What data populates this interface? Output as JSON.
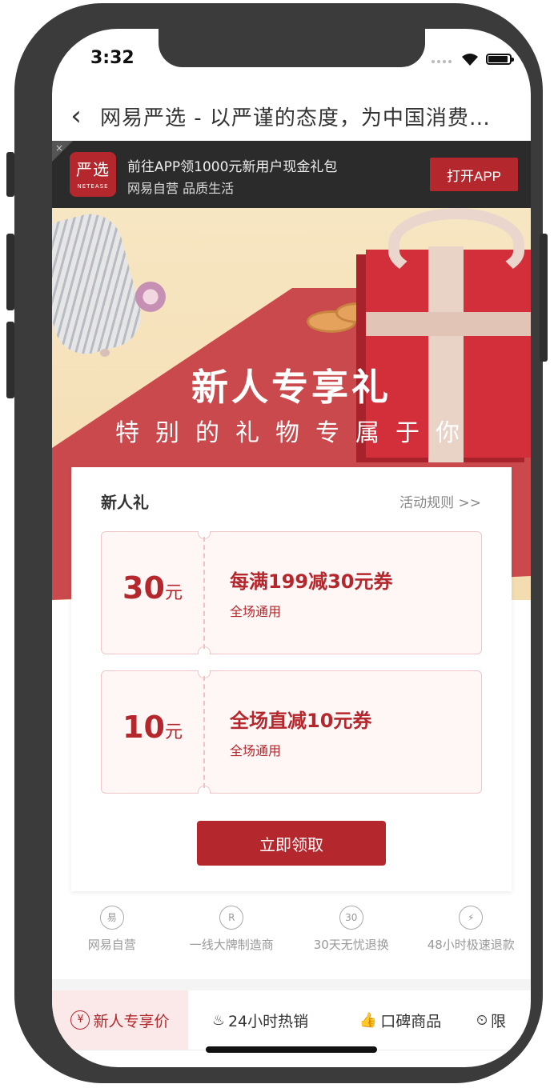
{
  "status": {
    "time": "3:32"
  },
  "nav": {
    "back_icon": "chevron-left-icon",
    "title": "网易严选 - 以严谨的态度，为中国消费者甄选天下优品"
  },
  "appbar": {
    "logo_cn": "严选",
    "logo_en": "NETEASE",
    "line1": "前往APP领1000元新用户现金礼包",
    "line2": "网易自营 品质生活",
    "open_label": "打开APP",
    "close_glyph": "×"
  },
  "hero": {
    "title": "新人专享礼",
    "subtitle": "特别的礼物专属于你"
  },
  "card": {
    "title": "新人礼",
    "rules": "活动规则 >>",
    "coupons": [
      {
        "amount": "30",
        "unit": "元",
        "title": "每满199减30元券",
        "sub": "全场通用"
      },
      {
        "amount": "10",
        "unit": "元",
        "title": "全场直减10元券",
        "sub": "全场通用"
      }
    ],
    "claim_label": "立即领取"
  },
  "features": [
    {
      "icon": "易",
      "label": "网易自营"
    },
    {
      "icon": "R",
      "label": "一线大牌制造商"
    },
    {
      "icon": "30",
      "label": "30天无忧退换"
    },
    {
      "icon": "⚡",
      "label": "48小时极速退款"
    }
  ],
  "tabs": [
    {
      "icon": "¥",
      "label": "新人专享价"
    },
    {
      "icon": "♨",
      "label": "24小时热销"
    },
    {
      "icon": "👍",
      "label": "口碑商品"
    },
    {
      "icon": "⏲",
      "label": "限"
    }
  ],
  "colors": {
    "brand": "#b4282d",
    "appbar": "#2b2b2b"
  }
}
